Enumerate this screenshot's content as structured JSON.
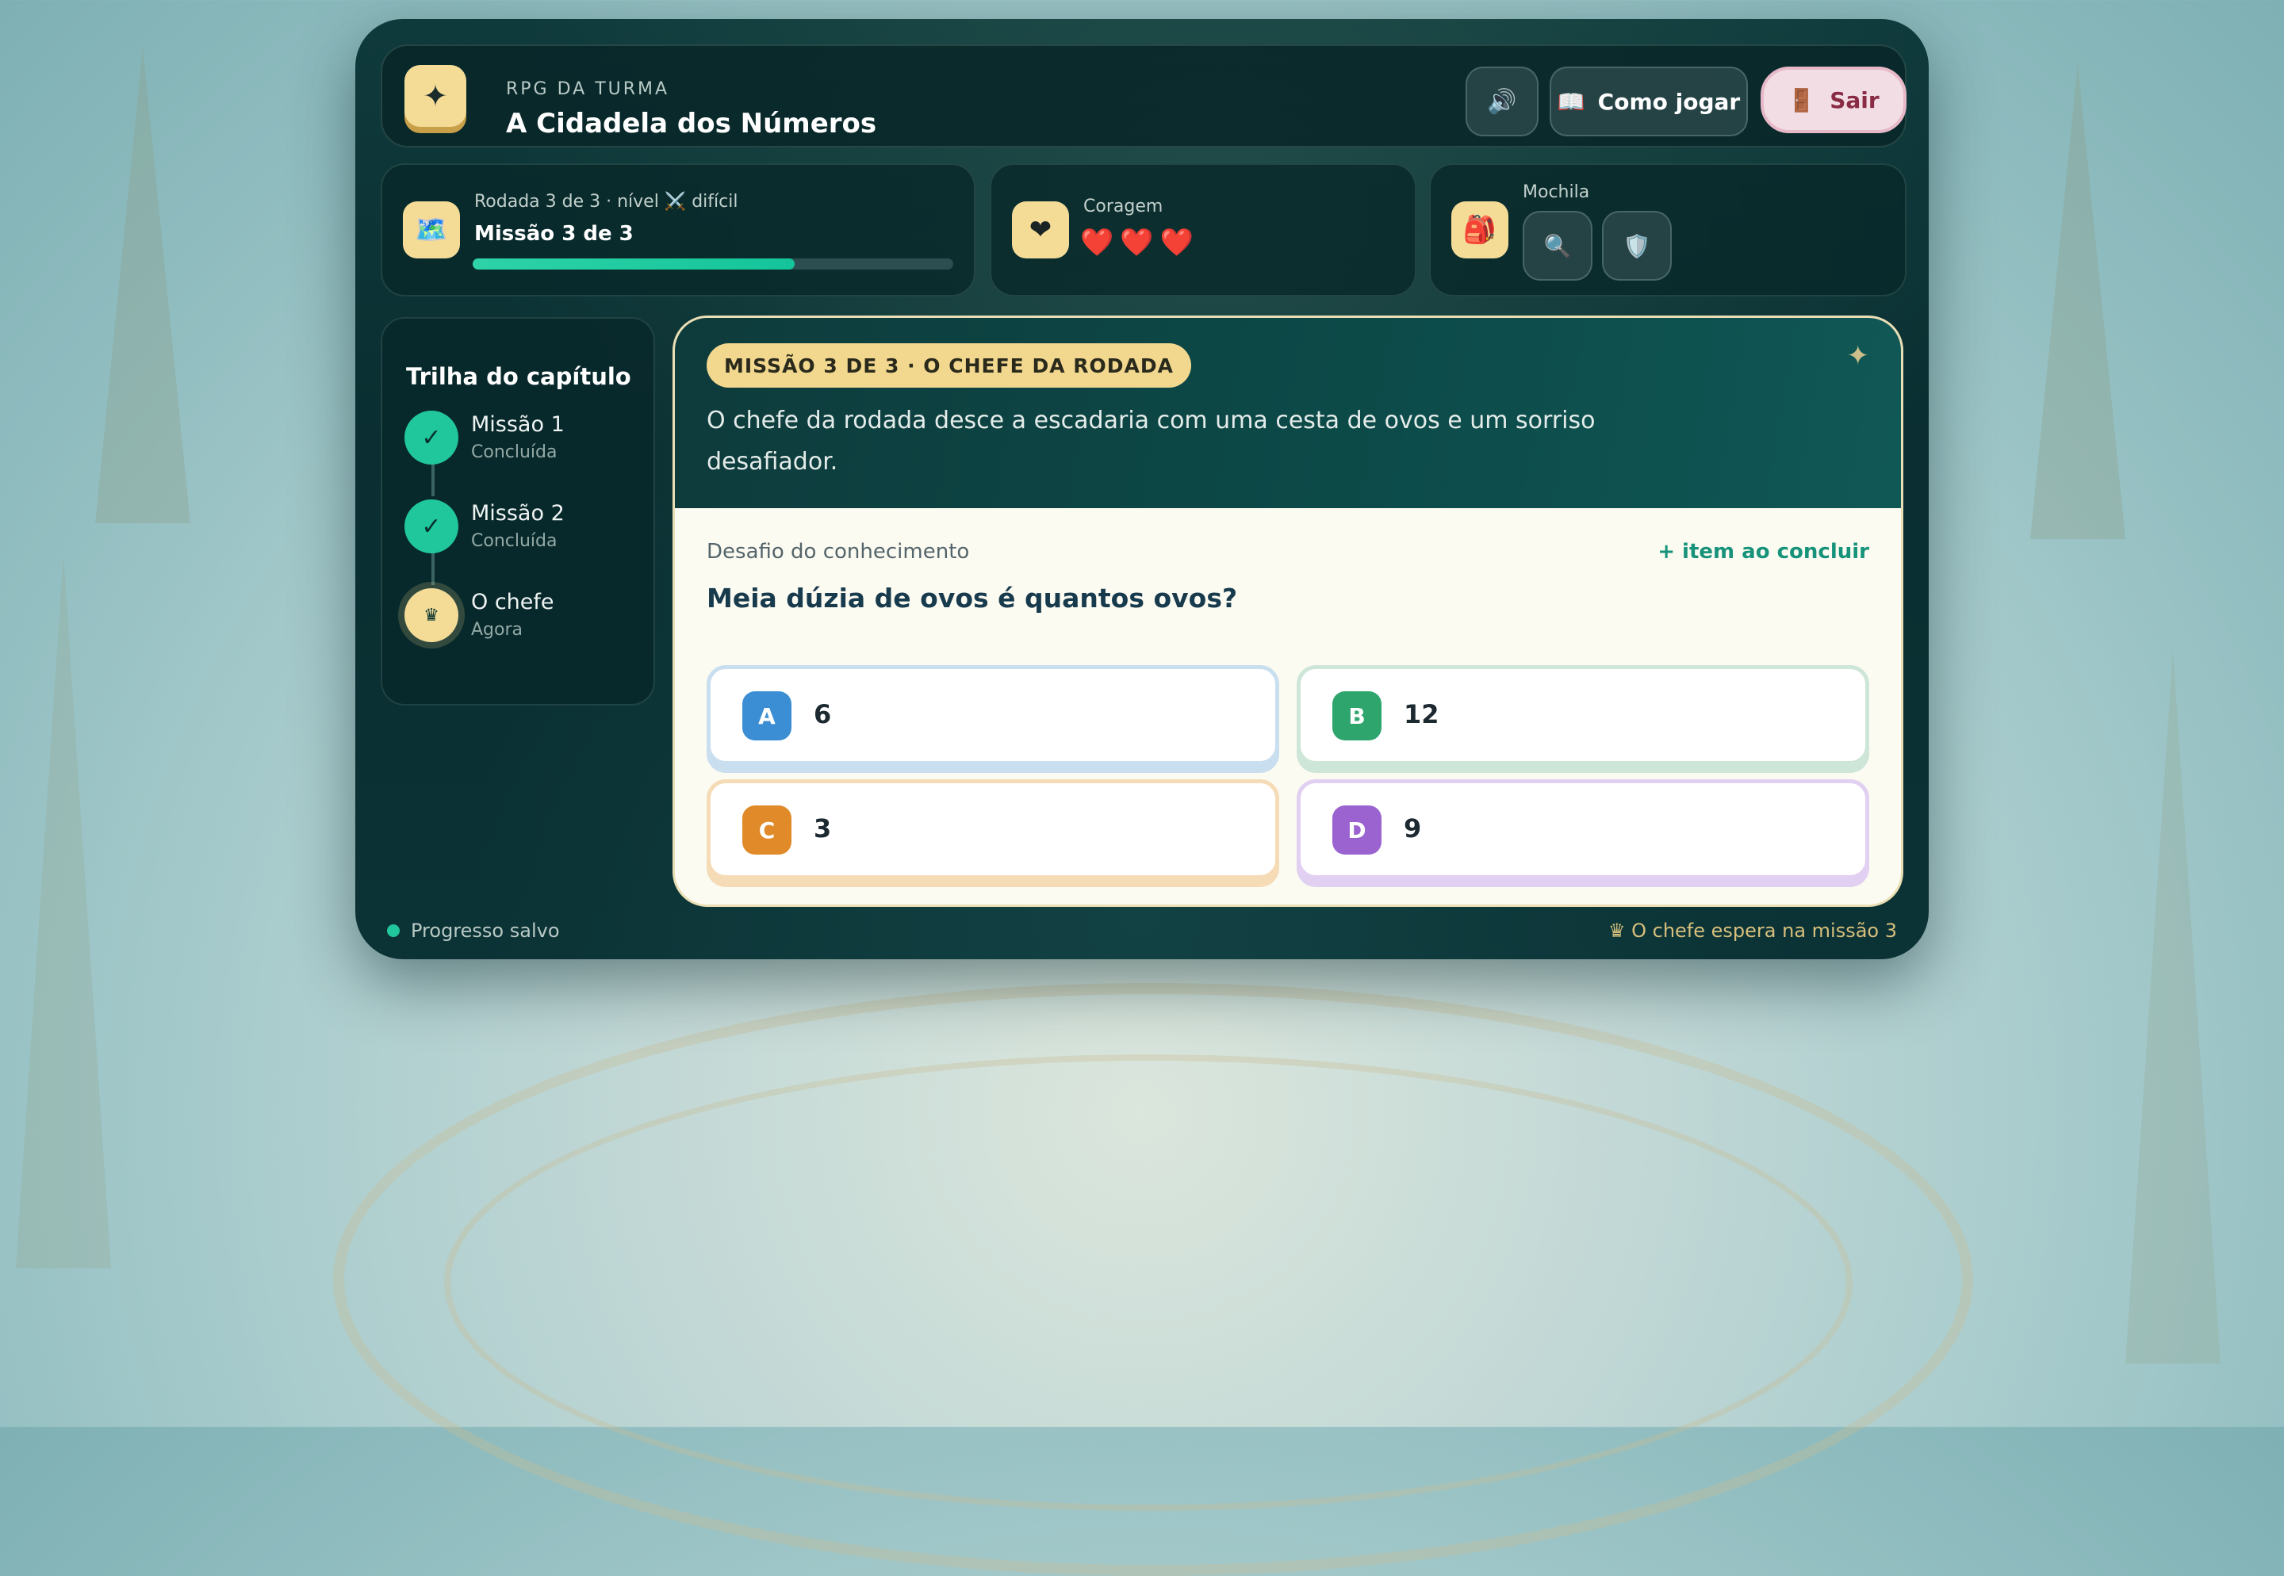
{
  "header": {
    "eyebrow": "RPG DA TURMA",
    "title": "A Cidadela dos Números",
    "logo_icon": "✦",
    "sound_icon": "🔊",
    "howto_icon": "📖",
    "howto_label": "Como jogar",
    "exit_icon": "🚪",
    "exit_label": "Sair"
  },
  "round": {
    "icon": "🗺️",
    "label": "Rodada 3 de 3 · nível ⚔️ difícil",
    "title": "Missão 3 de 3",
    "progress": 0.67
  },
  "courage": {
    "icon": "❤",
    "label": "Coragem",
    "hearts": "❤️❤️❤️"
  },
  "backpack": {
    "icon": "🎒",
    "label": "Mochila",
    "items": [
      "🔍",
      "🛡️"
    ]
  },
  "trail": {
    "title": "Trilha do capítulo",
    "steps": [
      {
        "name": "Missão 1",
        "status": "Concluída",
        "icon": "✓"
      },
      {
        "name": "Missão 2",
        "status": "Concluída",
        "icon": "✓"
      },
      {
        "name": "O chefe",
        "status": "Agora",
        "icon": "♛"
      }
    ]
  },
  "mission": {
    "badge": "MISSÃO 3 DE 3 · O CHEFE DA RODADA",
    "sparkle": "✦",
    "narrative": "O chefe da rodada desce a escadaria com uma cesta de ovos e um sorriso desafiador.",
    "challenge_label": "Desafio do conhecimento",
    "reward": "+ item ao concluir",
    "question": "Meia dúzia de ovos é quantos ovos?",
    "answers": [
      {
        "key": "A",
        "value": "6",
        "color": "#3b8ed4",
        "border": "#c9dff0"
      },
      {
        "key": "B",
        "value": "12",
        "color": "#2fa56e",
        "border": "#cde6d8"
      },
      {
        "key": "C",
        "value": "3",
        "color": "#e08a2a",
        "border": "#f5dcb7"
      },
      {
        "key": "D",
        "value": "9",
        "color": "#9a63d0",
        "border": "#e1d0f1"
      }
    ]
  },
  "footer": {
    "saved": "Progresso salvo",
    "boss_note": "♛ O chefe espera na missão 3"
  }
}
